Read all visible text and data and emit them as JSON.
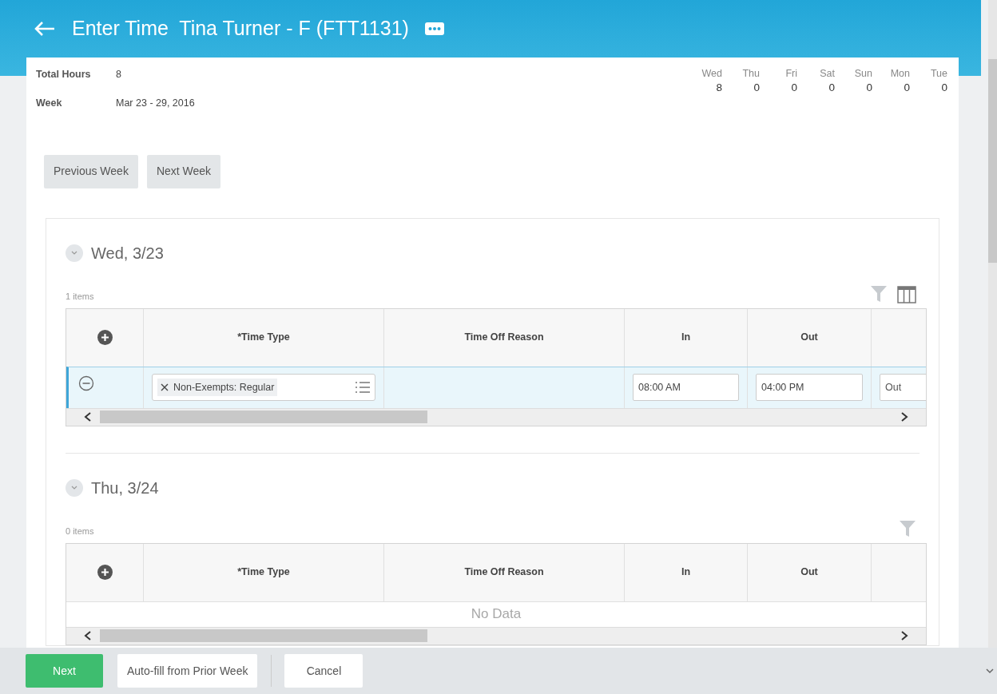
{
  "header": {
    "title": "Enter Time  Tina Turner - F (FTT1131)"
  },
  "summary": {
    "fields": [
      {
        "label": "Total Hours",
        "value": "8"
      },
      {
        "label": "Week",
        "value": "Mar 23 - 29, 2016"
      }
    ],
    "days": [
      {
        "day": "Wed",
        "hours": "8"
      },
      {
        "day": "Thu",
        "hours": "0"
      },
      {
        "day": "Fri",
        "hours": "0"
      },
      {
        "day": "Sat",
        "hours": "0"
      },
      {
        "day": "Sun",
        "hours": "0"
      },
      {
        "day": "Mon",
        "hours": "0"
      },
      {
        "day": "Tue",
        "hours": "0"
      }
    ]
  },
  "week_buttons": [
    "Previous Week",
    "Next Week"
  ],
  "sections": [
    {
      "date": "Wed, 3/23",
      "expanded": true,
      "count": "1 items",
      "columns_toggle": true,
      "columns": [
        "*Time Type",
        "Time Off Reason",
        "In",
        "Out"
      ],
      "rows": [
        {
          "time_type": "Non-Exempts: Regular",
          "in": "08:00 AM",
          "out": "04:00 PM",
          "column_6": {
            "placeholder": "Out"
          },
          "selected": true
        }
      ]
    },
    {
      "date": "Thu, 3/24",
      "expanded": true,
      "count": "0 items",
      "columns_toggle": false,
      "columns": [
        "*Time Type",
        "Time Off Reason",
        "In",
        "Out"
      ],
      "empty_text": "No Data"
    }
  ],
  "footer_buttons": [
    {
      "label": "Next",
      "kind": "primary"
    },
    {
      "label": "Auto-fill from Prior Week",
      "kind": "secondary"
    },
    {
      "label": "Cancel",
      "kind": "secondary"
    }
  ]
}
